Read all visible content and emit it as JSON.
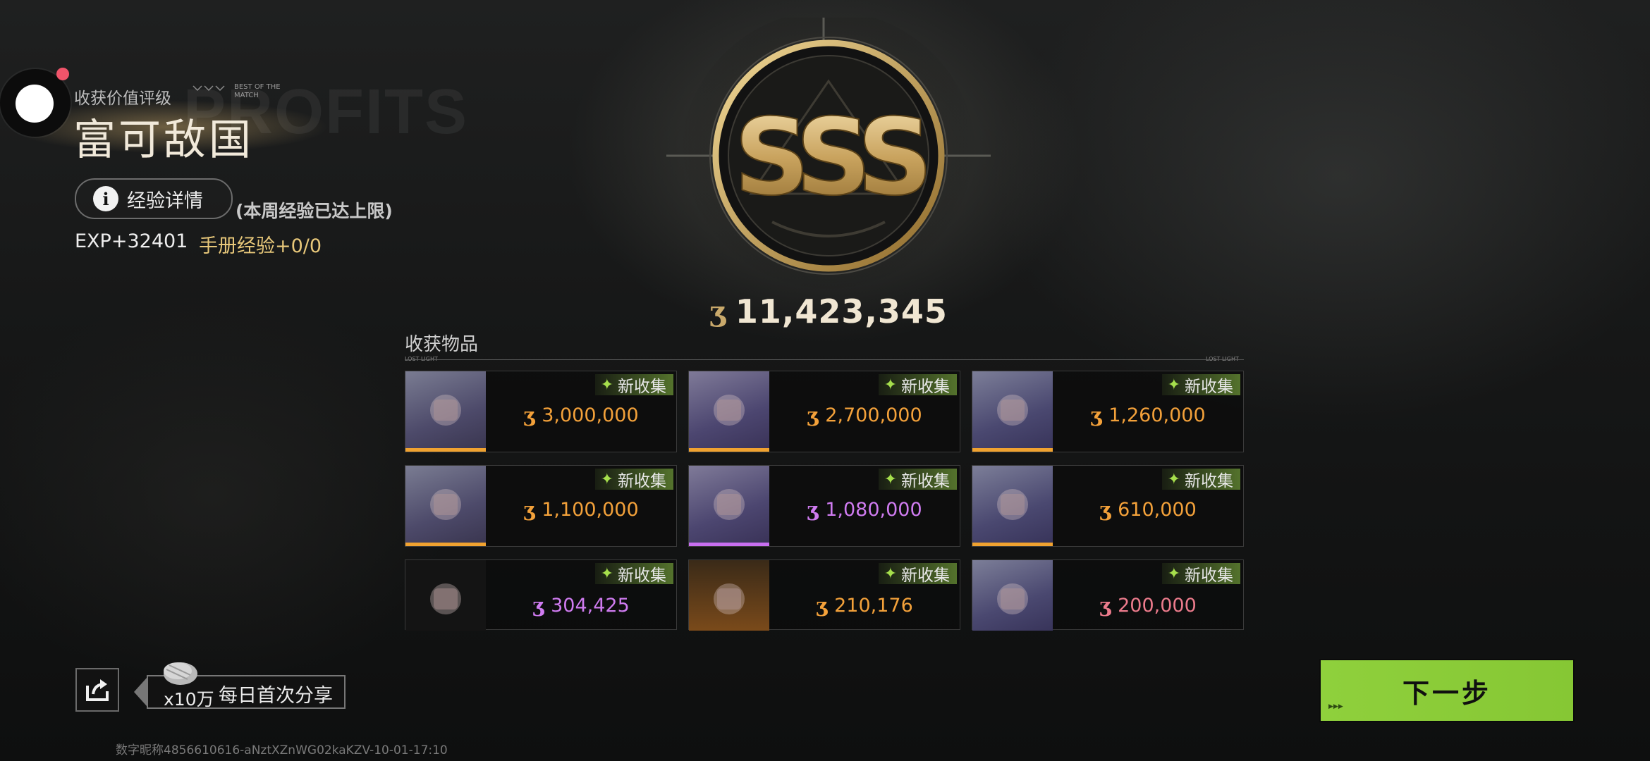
{
  "rating": {
    "label": "收获价值评级",
    "tag": "BEST OF THE MATCH",
    "bg_word": "PROFITS",
    "title": "富可敌国"
  },
  "experience": {
    "button_label": "经验详情",
    "note": "(本周经验已达上限)",
    "exp": "EXP+32401",
    "handbook": "手册经验+0/0"
  },
  "grade": "SSS",
  "total_value": "11,423,345",
  "items": {
    "title": "收获物品",
    "line_left": "LOST LIGHT",
    "line_right": "LOST LIGHT",
    "new_tag": "新收集",
    "list": [
      {
        "icon": "warship-model",
        "price": "3,000,000",
        "color": "#f3a13a",
        "bar": "#f0a230"
      },
      {
        "icon": "commemorative-coin",
        "price": "2,700,000",
        "color": "#f3a13a",
        "bar": "#f0a230"
      },
      {
        "icon": "ornate-sword",
        "price": "1,260,000",
        "color": "#f3a13a",
        "bar": "#f0a230"
      },
      {
        "icon": "bronze-vase",
        "price": "1,100,000",
        "color": "#f3a13a",
        "bar": "#f0a230"
      },
      {
        "icon": "octopus-ring",
        "price": "1,080,000",
        "color": "#cf7bf0",
        "bar": "#c86ff0"
      },
      {
        "icon": "trophy-cup",
        "price": "610,000",
        "color": "#f3a13a",
        "bar": "#f0a230"
      },
      {
        "icon": "assault-rifle",
        "price": "304,425",
        "color": "#cf7bf0",
        "bar": "#c86ff0"
      },
      {
        "icon": "fire-extinguisher",
        "price": "210,176",
        "color": "#f3a13a",
        "bar": "#f0a230"
      },
      {
        "icon": "feather-blade",
        "price": "200,000",
        "color": "#ec7b8c",
        "bar": "#e86a80"
      }
    ]
  },
  "share": {
    "reward_qty": "x10万",
    "label": "每日首次分享"
  },
  "next_button": "下一步",
  "watermark": "数字昵称4856610616-aNztXZnWG02kaKZV-10-01-17:10"
}
